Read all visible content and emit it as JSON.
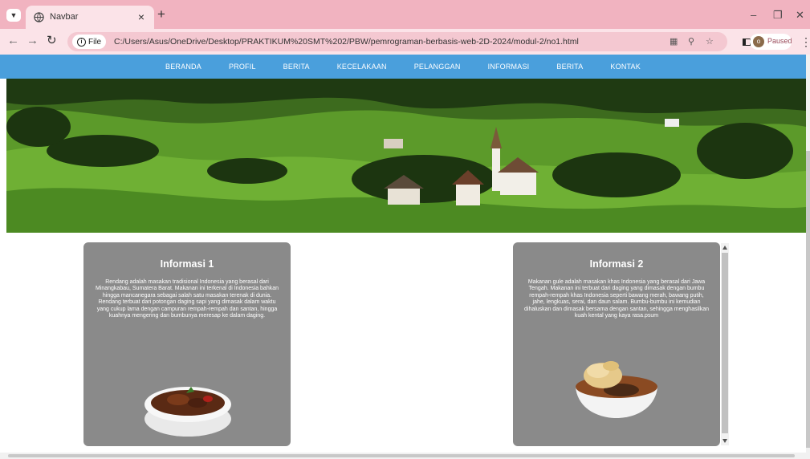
{
  "browser": {
    "tab_title": "Navbar",
    "url": "C:/Users/Asus/OneDrive/Desktop/PRAKTIKUM%20SMT%202/PBW/pemrograman-berbasis-web-2D-2024/modul-2/no1.html",
    "site_chip_label": "File",
    "profile_status": "Paused"
  },
  "navbar": {
    "items": [
      "BERANDA",
      "PROFIL",
      "BERITA",
      "KECELAKAAN",
      "PELANGGAN",
      "INFORMASI",
      "BERITA",
      "KONTAK"
    ]
  },
  "cards": [
    {
      "title": "Informasi 1",
      "text": "Rendang adalah masakan tradisional Indonesia yang berasal dari Minangkabau, Sumatera Barat. Makanan ini terkenal di Indonesia bahkan hingga mancanegara sebagai salah satu masakan terenak di dunia. Rendang terbuat dari potongan daging sapi yang dimasak dalam waktu yang cukup lama dengan campuran rempah-rempah dan santan, hingga kuahnya mengering dan bumbunya meresap ke dalam daging."
    },
    {
      "title": "Informasi 2",
      "text": "Makanan gule adalah masakan khas Indonesia yang berasal dari Jawa Tengah. Makanan ini terbuat dari daging yang dimasak dengan bumbu rempah-rempah khas Indonesia seperti bawang merah, bawang putih, jahe, lengkuas, serai, dan daun salam. Bumbu-bumbu ini kemudian dihaluskan dan dimasak bersama dengan santan, sehingga menghasilkan kuah kental yang kaya rasa.psum"
    }
  ],
  "colors": {
    "tabstrip": "#f1b3c0",
    "navbar": "#4a9fdc",
    "card": "#8a8a8a"
  }
}
